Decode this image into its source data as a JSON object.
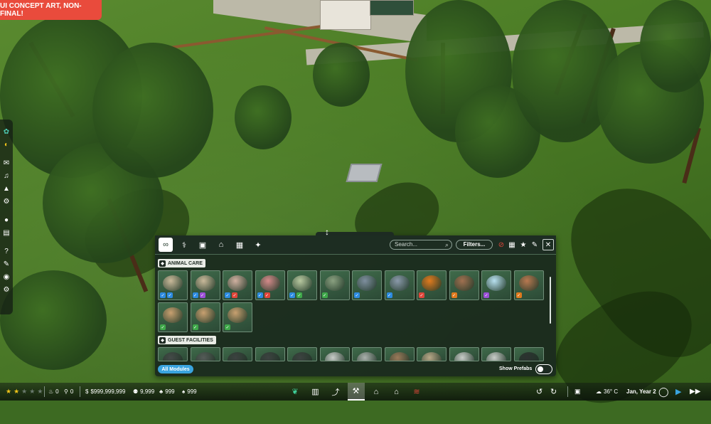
{
  "app": {
    "concept_badge": "UI CONCEPT ART, NON-FINAL!"
  },
  "sidebar": {
    "items": [
      {
        "icon": "molecule-icon",
        "glyph": "✿"
      },
      {
        "icon": "power-icon",
        "glyph": "◐"
      },
      {
        "icon": "mail-icon",
        "glyph": "✉"
      },
      {
        "icon": "bell-icon",
        "glyph": "🔔"
      },
      {
        "icon": "warning-icon",
        "glyph": "▲"
      },
      {
        "icon": "settings-gear-icon",
        "glyph": "⚙"
      },
      {
        "icon": "paw-icon",
        "glyph": "●"
      },
      {
        "icon": "clipboard-icon",
        "glyph": "▤"
      },
      {
        "icon": "help-icon",
        "glyph": "?"
      },
      {
        "icon": "wrench-icon",
        "glyph": "✎"
      },
      {
        "icon": "camera-icon",
        "glyph": "◉"
      },
      {
        "icon": "gear-icon",
        "glyph": "⚙"
      }
    ]
  },
  "panel": {
    "tabs": [
      {
        "icon": "infinity-icon",
        "glyph": "∞",
        "active": true
      },
      {
        "icon": "animal-care-icon",
        "glyph": "⚕",
        "active": false
      },
      {
        "icon": "guest-facilities-icon",
        "glyph": "▣",
        "active": false
      },
      {
        "icon": "habitat-icon",
        "glyph": "⌂",
        "active": false
      },
      {
        "icon": "terrain-icon",
        "glyph": "▦",
        "active": false
      },
      {
        "icon": "paths-icon",
        "glyph": "✦",
        "active": false
      }
    ],
    "search_placeholder": "Search...",
    "search_icon": "magnifier-icon",
    "filters_label": "Filters...",
    "header_buttons": [
      {
        "icon": "clear-filter-icon",
        "glyph": "⊘"
      },
      {
        "icon": "grid-view-icon",
        "glyph": "▦"
      },
      {
        "icon": "favorite-star-icon",
        "glyph": "★"
      },
      {
        "icon": "pin-icon",
        "glyph": "✎"
      },
      {
        "icon": "close-icon",
        "glyph": "✕"
      }
    ],
    "sections": [
      {
        "title": "ANIMAL CARE",
        "icon": "animal-care-icon",
        "items": [
          {
            "name": "feeder-tray",
            "color": "#c9b99a",
            "badges": [
              "#2d8be0",
              "#2d8be0"
            ]
          },
          {
            "name": "enrichment-mat",
            "color": "#c9b99a",
            "badges": [
              "#2d8be0",
              "#9b4fd6"
            ]
          },
          {
            "name": "feeding-station",
            "color": "#d0b0a0",
            "badges": [
              "#2d8be0",
              "#e0453a"
            ]
          },
          {
            "name": "enrichment-pad-red",
            "color": "#d48a8a",
            "badges": [
              "#2d8be0",
              "#e0453a"
            ]
          },
          {
            "name": "feeder-green",
            "color": "#b8c8a0",
            "badges": [
              "#2d8be0",
              "#3fa84a"
            ]
          },
          {
            "name": "salt-lick-pole",
            "color": "#8aa080",
            "badges": [
              "#3fa84a"
            ]
          },
          {
            "name": "water-trough",
            "color": "#7e8e9e",
            "badges": [
              "#2d8be0"
            ]
          },
          {
            "name": "fish-feeder",
            "color": "#8a99aa",
            "badges": [
              "#2d8be0"
            ]
          },
          {
            "name": "pumpkin",
            "color": "#e07a1e",
            "badges": [
              "#e0453a"
            ]
          },
          {
            "name": "log-pile",
            "color": "#a07050",
            "badges": [
              "#e07a1e"
            ]
          },
          {
            "name": "ice-block",
            "color": "#b8e0f0",
            "badges": [
              "#9b4fd6"
            ]
          },
          {
            "name": "termite-mound",
            "color": "#b87850",
            "badges": [
              "#e07a1e"
            ]
          },
          {
            "name": "sand-patch-1",
            "color": "#c8a070",
            "badges": [
              "#3fa84a"
            ]
          },
          {
            "name": "sand-patch-2",
            "color": "#c8a070",
            "badges": [
              "#3fa84a"
            ]
          },
          {
            "name": "sand-patch-3",
            "color": "#c8a070",
            "badges": [
              "#3fa84a"
            ]
          }
        ]
      },
      {
        "title": "GUEST FACILITIES",
        "icon": "guest-facilities-icon",
        "items": [
          {
            "name": "kiosk",
            "color": "#444a48"
          },
          {
            "name": "shop",
            "color": "#555b58"
          },
          {
            "name": "bin",
            "color": "#3c4240"
          },
          {
            "name": "water-fountain",
            "color": "#3c4240"
          },
          {
            "name": "lamp",
            "color": "#3c4240"
          },
          {
            "name": "sign",
            "color": "#c8ccc8"
          },
          {
            "name": "info-board",
            "color": "#aab0ac"
          },
          {
            "name": "rocks",
            "color": "#9a7a5a"
          },
          {
            "name": "planter",
            "color": "#b8a888"
          },
          {
            "name": "vending",
            "color": "#c8ccc8"
          },
          {
            "name": "toilet",
            "color": "#c8ccc8"
          },
          {
            "name": "bench",
            "color": "#2c3230"
          }
        ]
      }
    ],
    "all_modules_label": "All Modules",
    "show_prefabs_label": "Show Prefabs",
    "show_prefabs_on": false
  },
  "bottom_bar": {
    "rating_stars": 2,
    "rating_max": 5,
    "stat_a": "0",
    "stat_b": "0",
    "money": "$999,999,999",
    "guests": "9,999",
    "stat_c": "999",
    "stat_d": "999",
    "modes": [
      {
        "icon": "habitat-tree-icon",
        "glyph": "❦",
        "active": false
      },
      {
        "icon": "fence-icon",
        "glyph": "▥",
        "active": false
      },
      {
        "icon": "path-icon",
        "glyph": "⤴",
        "active": false
      },
      {
        "icon": "construction-icon",
        "glyph": "⚒",
        "active": true
      },
      {
        "icon": "facilities-icon",
        "glyph": "⌂",
        "active": false
      },
      {
        "icon": "shop-icon",
        "glyph": "⌂",
        "active": false
      },
      {
        "icon": "terrain-tool-icon",
        "glyph": "≋",
        "active": false
      }
    ],
    "undo_icon": "undo-icon",
    "redo_icon": "redo-icon",
    "temperature": "36° C",
    "date": "Jan, Year 2"
  }
}
